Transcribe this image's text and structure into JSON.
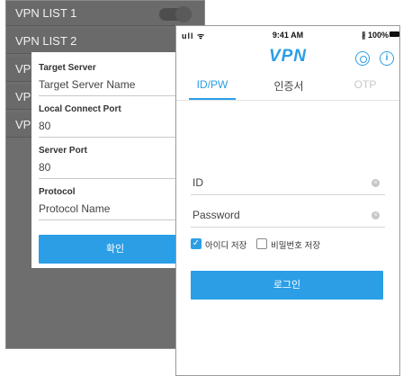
{
  "vpn_list": {
    "items": [
      "VPN LIST 1",
      "VPN LIST 2",
      "VP",
      "VP",
      "VP"
    ]
  },
  "dialog": {
    "target_server": {
      "label": "Target Server",
      "value": "Target Server Name"
    },
    "local_port": {
      "label": "Local Connect Port",
      "value": "80"
    },
    "server_port": {
      "label": "Server Port",
      "value": "80"
    },
    "protocol": {
      "label": "Protocol",
      "value": "Protocol Name"
    },
    "confirm_label": "확인"
  },
  "status_bar": {
    "signal": "ull ᯤ",
    "time": "9:41 AM",
    "battery": "∦ 100%"
  },
  "app": {
    "title": "VPN",
    "info_glyph": "i"
  },
  "tabs": [
    {
      "label": "ID/PW",
      "state": "active"
    },
    {
      "label": "인증서",
      "state": "normal"
    },
    {
      "label": "OTP",
      "state": "disabled"
    }
  ],
  "login": {
    "id_placeholder": "ID",
    "password_placeholder": "Password",
    "save_id_label": "아이디 저장",
    "save_id_checked": true,
    "save_password_label": "비밀번호 저장",
    "save_password_checked": false,
    "login_label": "로그인"
  },
  "colors": {
    "accent": "#2b9ee6",
    "overlay": "#6e6e6e"
  },
  "icons": {
    "settings": "gear-icon",
    "info": "info-icon",
    "clear": "clear-icon",
    "check": "check-icon"
  }
}
